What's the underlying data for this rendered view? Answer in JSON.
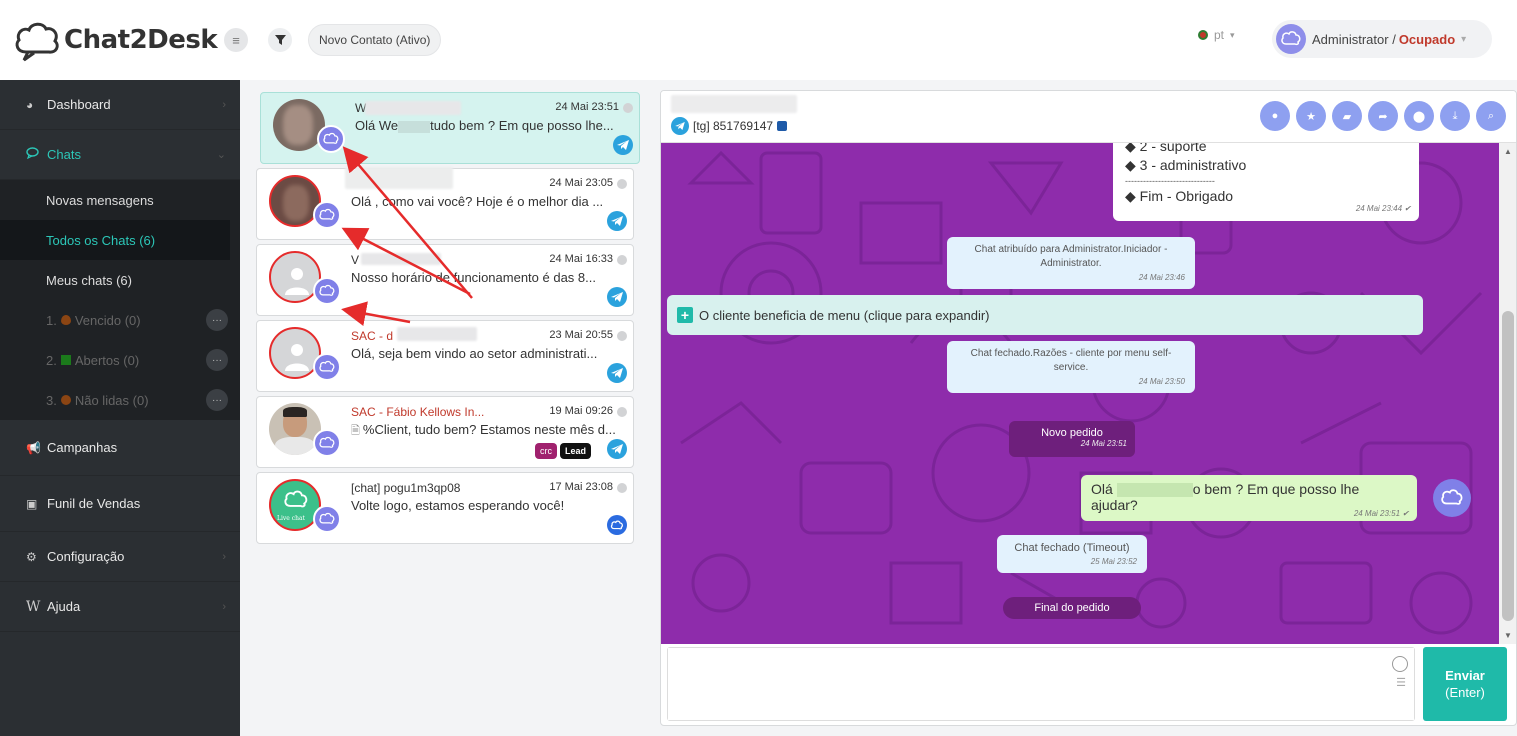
{
  "app": {
    "logo_text": "Chat2Desk"
  },
  "sidebar": {
    "items": [
      {
        "label": "Dashboard",
        "icon": "dashboard-icon"
      },
      {
        "label": "Chats",
        "icon": "chat-bubble-icon"
      },
      {
        "label": "Campanhas",
        "icon": "megaphone-icon"
      },
      {
        "label": "Funil de Vendas",
        "icon": "funnel-icon"
      },
      {
        "label": "Configuração",
        "icon": "gear-icon"
      },
      {
        "label": "Ajuda",
        "icon": "wikipedia-icon"
      }
    ],
    "chat_sub": [
      {
        "label": "Novas mensagens"
      },
      {
        "label": "Todos os Chats (6)"
      },
      {
        "label": "Meus chats (6)"
      },
      {
        "prefix": "1.",
        "label": "Vencido (0)",
        "color": "#8b4513"
      },
      {
        "prefix": "2.",
        "label": "Abertos (0)",
        "color": "#1b7a1b"
      },
      {
        "prefix": "3.",
        "label": "Não lidas (0)",
        "color": "#8b4513"
      }
    ],
    "dots_label": "···"
  },
  "topbar": {
    "contact_filter": "Novo Contato (Ativo)",
    "language": "pt",
    "user": "Administrator /",
    "status": "Ocupado"
  },
  "chats": [
    {
      "name": "W",
      "time": "24 Mai 23:51",
      "preview_a": "Olá We",
      "preview_b": "tudo bem ? Em que posso lhe...",
      "channel": "telegram"
    },
    {
      "name": "",
      "time": "24 Mai 23:05",
      "preview": "Olá , como vai você? Hoje é o melhor dia ...",
      "channel": "telegram"
    },
    {
      "name": "V",
      "time": "24 Mai 16:33",
      "preview": "Nosso horário de funcionamento é das 8...",
      "channel": "telegram"
    },
    {
      "name": "SAC - d",
      "time": "23 Mai 20:55",
      "preview": "Olá, seja bem vindo ao setor administrati...",
      "channel": "telegram"
    },
    {
      "name": "SAC - Fábio Kellows In...",
      "time": "19 Mai 09:26",
      "preview": "%Client, tudo bem? Estamos neste mês d...",
      "channel": "telegram",
      "tags": [
        "crc",
        "Lead"
      ]
    },
    {
      "name": "[chat] pogu1m3qp08",
      "time": "17 Mai 23:08",
      "preview": "Volte logo, estamos esperando você!",
      "channel": "web-chat",
      "avatar_text": "Live chat"
    }
  ],
  "conversation": {
    "header_id": "[tg] 851769147",
    "tool_icons": [
      "user-icon",
      "star-icon",
      "comment-icon",
      "share-icon",
      "circle-icon",
      "download-icon",
      "search-icon"
    ],
    "menu_lines": [
      "◆ 2 - suporte",
      "◆ 3 - administrativo",
      "------------------------------",
      "◆ Fim - Obrigado"
    ],
    "menu_time": "24 Mai 23:44 ✔",
    "sys1": "Chat atribuído para Administrator.Iniciador - Administrator.",
    "sys1_time": "24 Mai 23:46",
    "menu_notice": "O cliente beneficia de menu (clique para expandir)",
    "sys2": "Chat fechado.Razões - cliente por menu self-service.",
    "sys2_time": "24 Mai 23:50",
    "order_new": "Novo pedido",
    "order_new_time": "24 Mai 23:51",
    "out_a": "Olá",
    "out_b": "o bem ? Em que posso lhe ajudar?",
    "out_time": "24 Mai 23:51 ✔",
    "sys3": "Chat fechado (Timeout)",
    "sys3_time": "25 Mai 23:52",
    "order_end": "Final do pedido"
  },
  "composer": {
    "placeholder": "",
    "send_label": "Enviar",
    "send_hint": "(Enter)"
  },
  "colors": {
    "accent": "#1fbaa9",
    "chat_bg": "#8e2cab",
    "brand_bubble": "#8080e8",
    "alert": "#e52b2b"
  }
}
